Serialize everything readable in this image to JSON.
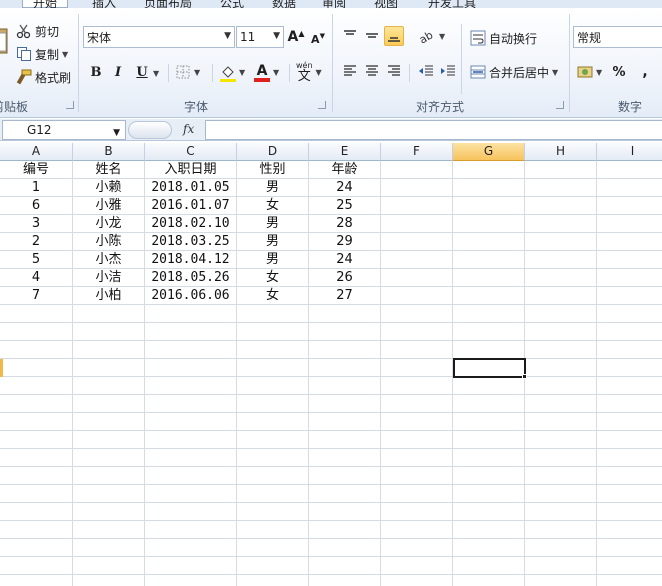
{
  "ribbon": {
    "tabs": [
      "开始",
      "插入",
      "页面布局",
      "公式",
      "数据",
      "审阅",
      "视图",
      "开发工具"
    ],
    "clipboard": {
      "cut": "剪切",
      "copy": "复制",
      "format_painter": "格式刷",
      "title": "剪贴板"
    },
    "font": {
      "name": "宋体",
      "size": "11",
      "bold": "B",
      "italic": "I",
      "underline": "U",
      "grow": "A",
      "shrink": "A",
      "wen": "wén",
      "wen_char": "文",
      "color_a": "A",
      "title": "字体",
      "fill_color": "#f5e600",
      "font_color": "#e0201c"
    },
    "alignment": {
      "wrap_text": "自动换行",
      "merge_center": "合并后居中",
      "title": "对齐方式"
    },
    "number": {
      "format": "常规",
      "percent": "%",
      "comma": ",",
      "title": "数字"
    }
  },
  "formula_bar": {
    "name_box": "G12",
    "fx": "fx",
    "value": ""
  },
  "grid": {
    "columns": [
      "A",
      "B",
      "C",
      "D",
      "E",
      "F",
      "G",
      "H",
      "I"
    ],
    "active_column": "G",
    "rows": [
      [
        "编号",
        "姓名",
        "入职日期",
        "性别",
        "年龄"
      ],
      [
        "1",
        "小赖",
        "2018.01.05",
        "男",
        "24"
      ],
      [
        "6",
        "小雅",
        "2016.01.07",
        "女",
        "25"
      ],
      [
        "3",
        "小龙",
        "2018.02.10",
        "男",
        "28"
      ],
      [
        "2",
        "小陈",
        "2018.03.25",
        "男",
        "29"
      ],
      [
        "5",
        "小杰",
        "2018.04.12",
        "男",
        "24"
      ],
      [
        "4",
        "小洁",
        "2018.05.26",
        "女",
        "26"
      ],
      [
        "7",
        "小柏",
        "2016.06.06",
        "女",
        "27"
      ]
    ]
  }
}
